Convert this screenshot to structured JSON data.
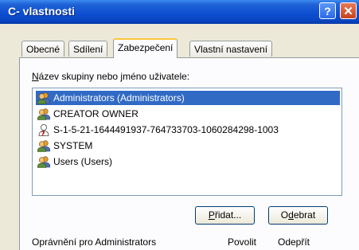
{
  "window": {
    "title": "C- vlastnosti",
    "help_label": "?",
    "close_label": "✕"
  },
  "tabs": [
    {
      "label": "Obecné"
    },
    {
      "label": "Sdílení"
    },
    {
      "label": "Zabezpečení",
      "active": true
    },
    {
      "label": "Vlastní nastavení"
    }
  ],
  "group_label": {
    "accel": "N",
    "rest": "ázev skupiny nebo jméno uživatele:"
  },
  "principals": [
    {
      "name": "Administrators (Administrators)",
      "icon": "group-icon",
      "selected": true
    },
    {
      "name": "CREATOR OWNER",
      "icon": "group-icon"
    },
    {
      "name": "S-1-5-21-1644491937-764733703-1060284298-1003",
      "icon": "unknown-user-icon"
    },
    {
      "name": "SYSTEM",
      "icon": "group-icon"
    },
    {
      "name": "Users (Users)",
      "icon": "group-icon"
    }
  ],
  "buttons": {
    "add": {
      "accel": "P",
      "rest": "řidat..."
    },
    "remove": {
      "pre": "O",
      "accel": "d",
      "rest": "ebrat"
    }
  },
  "permissions": {
    "label": "Oprávnění pro Administrators",
    "allow": "Povolit",
    "deny": "Odepřít"
  },
  "colors": {
    "selection": "#316ac5",
    "titlebar": "#0a46c2",
    "active_tab_accent": "#ffc83c"
  }
}
